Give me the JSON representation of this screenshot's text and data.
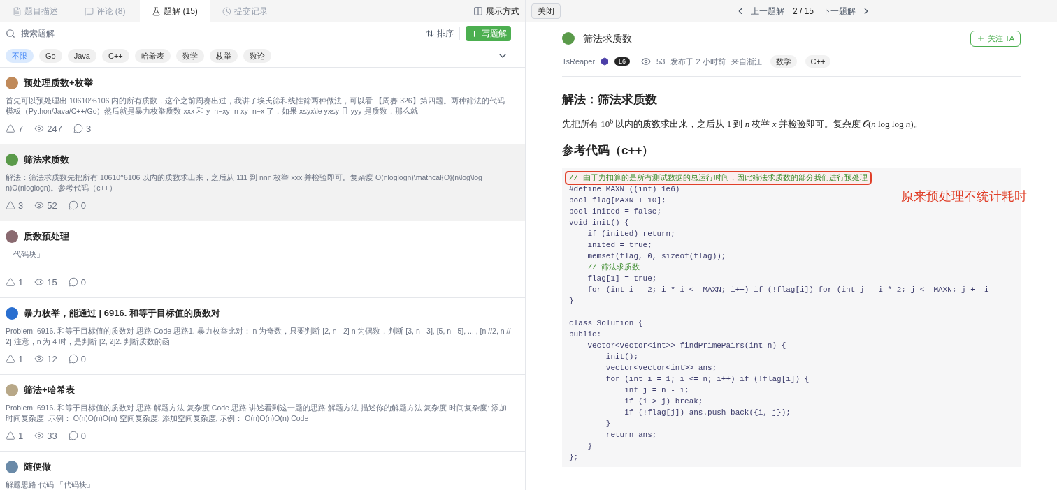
{
  "tabs": [
    {
      "label": "题目描述",
      "selected": false
    },
    {
      "label": "评论 (8)",
      "selected": false
    },
    {
      "label": "题解 (15)",
      "selected": true
    },
    {
      "label": "提交记录",
      "selected": false
    }
  ],
  "toolbar": {
    "layout_label": "展示方式",
    "close_label": "关闭",
    "prev_label": "上一题解",
    "page": "2 / 15",
    "next_label": "下一题解"
  },
  "search": {
    "placeholder": "搜索题解"
  },
  "sort_label": "排序",
  "write_label": "写题解",
  "filters": [
    {
      "label": "不限",
      "selected": true
    },
    {
      "label": "Go",
      "selected": false
    },
    {
      "label": "Java",
      "selected": false
    },
    {
      "label": "C++",
      "selected": false
    },
    {
      "label": "哈希表",
      "selected": false
    },
    {
      "label": "数学",
      "selected": false
    },
    {
      "label": "枚举",
      "selected": false
    },
    {
      "label": "数论",
      "selected": false
    }
  ],
  "solutions": [
    {
      "title": "预处理质数+枚举",
      "summary": "首先可以预处理出 10610^6106 内的所有质数，这个之前周赛出过，我讲了埃氏筛和线性筛两种做法，可以看 【周赛 326】第四题。两种筛法的代码模板（Python/Java/C++/Go）然后就是暴力枚举质数 xxx 和 y=n−xy=n-xy=n−x 了，如果 x≤yx\\le yx≤y 且 yyy 是质数，那么就",
      "likes": "7",
      "views": "247",
      "comments": "3",
      "color": "#c08a5a",
      "selected": false
    },
    {
      "title": "筛法求质数",
      "summary": "解法：筛法求质数先把所有 10610^6106 以内的质数求出来，之后从 111 到 nnn 枚举 xxx 并检验即可。复杂度 O(nloglogn)\\mathcal{O}(n\\log\\log n)O(nloglogn)。参考代码（c++）",
      "likes": "3",
      "views": "52",
      "comments": "0",
      "color": "#5a9a4a",
      "selected": true
    },
    {
      "title": "质数预处理",
      "summary": "「代码块」",
      "likes": "1",
      "views": "15",
      "comments": "0",
      "color": "#8a6a70",
      "selected": false
    },
    {
      "title": "暴力枚举，能通过 | 6916. 和等于目标值的质数对",
      "summary": "Problem: 6916. 和等于目标值的质数对 思路 Code 思路1. 暴力枚举比对： n 为奇数，只要判断 [2, n - 2] n 为偶数，判断 [3, n - 3], [5, n - 5], ... , [n //2, n // 2] 注意，n 为 4 时，是判断 [2, 2]2. 判断质数的函",
      "likes": "1",
      "views": "12",
      "comments": "0",
      "color": "#2a6fd0",
      "selected": false
    },
    {
      "title": "筛法+哈希表",
      "summary": "Problem: 6916. 和等于目标值的质数对 思路 解题方法 复杂度 Code 思路 讲述看到这一题的思路 解题方法 描述你的解题方法 复杂度 时间复杂度: 添加时间复杂度, 示例： O(n)O(n)O(n) 空间复杂度: 添加空间复杂度, 示例： O(n)O(n)O(n) Code",
      "likes": "1",
      "views": "33",
      "comments": "0",
      "color": "#b8a888",
      "selected": false
    },
    {
      "title": "随便做",
      "summary": "解题思路 代码 「代码块」",
      "color": "#6a8aa8",
      "selected": false
    }
  ],
  "article": {
    "title": "筛法求质数",
    "follow_label": "关注 TA",
    "author": "TsReaper",
    "level": "L6",
    "views": "53",
    "posted": "发布于 2 小时前",
    "location": "来自浙江",
    "tags": [
      "数学",
      "C++"
    ],
    "heading": "解法：筛法求质数",
    "paragraph": "先把所有 10$^{6}$ 以内的质数求出来，之后从 1 到 *n* 枚举 *x* 并检验即可。复杂度 𝒪(*n* log log *n*)。",
    "code_heading": "参考代码（c++）",
    "code": [
      {
        "text": "// 由于力扣算的是所有测试数据的总运行时间，因此筛法求质数的部分我们进行预处理",
        "kind": "comment",
        "highlighted": true
      },
      {
        "text": "#define MAXN ((int) 1e6)",
        "kind": "code",
        "highlighted": false
      },
      {
        "text": "bool flag[MAXN + 10];",
        "kind": "code",
        "highlighted": false
      },
      {
        "text": "bool inited = false;",
        "kind": "code",
        "highlighted": false
      },
      {
        "text": "void init() {",
        "kind": "code",
        "highlighted": false
      },
      {
        "text": "    if (inited) return;",
        "kind": "code",
        "highlighted": false
      },
      {
        "text": "    inited = true;",
        "kind": "code",
        "highlighted": false
      },
      {
        "text": "    memset(flag, 0, sizeof(flag));",
        "kind": "code",
        "highlighted": false
      },
      {
        "text": "    // 筛法求质数",
        "kind": "comment",
        "highlighted": false
      },
      {
        "text": "    flag[1] = true;",
        "kind": "code",
        "highlighted": false
      },
      {
        "text": "    for (int i = 2; i * i <= MAXN; i++) if (!flag[i]) for (int j = i * 2; j <= MAXN; j += i",
        "kind": "code",
        "highlighted": false
      },
      {
        "text": "}",
        "kind": "code",
        "highlighted": false
      },
      {
        "kind": "blank",
        "highlighted": false
      },
      {
        "text": "class Solution {",
        "kind": "code",
        "highlighted": false
      },
      {
        "text": "public:",
        "kind": "code",
        "highlighted": false
      },
      {
        "text": "    vector<vector<int>> findPrimePairs(int n) {",
        "kind": "code",
        "highlighted": false
      },
      {
        "text": "        init();",
        "kind": "code",
        "highlighted": false
      },
      {
        "text": "        vector<vector<int>> ans;",
        "kind": "code",
        "highlighted": false
      },
      {
        "text": "        for (int i = 1; i <= n; i++) if (!flag[i]) {",
        "kind": "code",
        "highlighted": false
      },
      {
        "text": "            int j = n - i;",
        "kind": "code",
        "highlighted": false
      },
      {
        "text": "            if (i > j) break;",
        "kind": "code",
        "highlighted": false
      },
      {
        "text": "            if (!flag[j]) ans.push_back({i, j});",
        "kind": "code",
        "highlighted": false
      },
      {
        "text": "        }",
        "kind": "code",
        "highlighted": false
      },
      {
        "text": "        return ans;",
        "kind": "code",
        "highlighted": false
      },
      {
        "text": "    }",
        "kind": "code",
        "highlighted": false
      },
      {
        "text": "};",
        "kind": "code",
        "highlighted": false
      }
    ],
    "annotation": "原来预处理不统计耗时"
  }
}
